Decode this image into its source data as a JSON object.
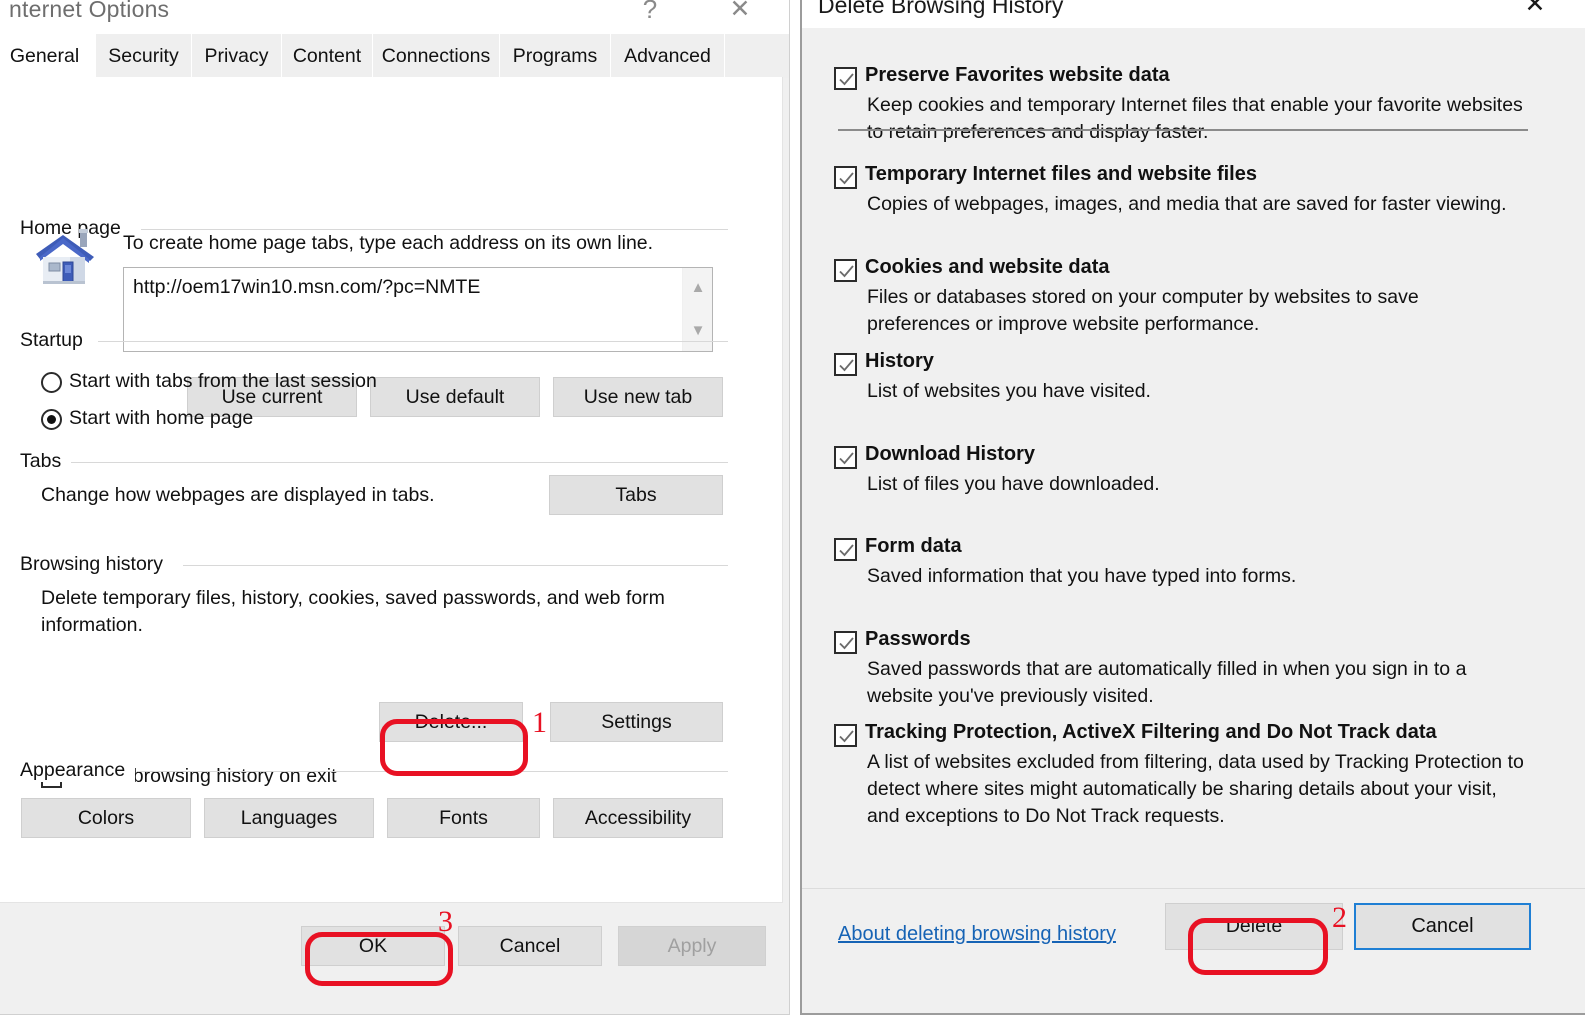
{
  "internet_options": {
    "window_title": "nternet Options",
    "titlebar_buttons": {
      "help": "?",
      "close": "✕"
    },
    "tabs": [
      {
        "label": "General",
        "active": true
      },
      {
        "label": "Security",
        "active": false
      },
      {
        "label": "Privacy",
        "active": false
      },
      {
        "label": "Content",
        "active": false
      },
      {
        "label": "Connections",
        "active": false
      },
      {
        "label": "Programs",
        "active": false
      },
      {
        "label": "Advanced",
        "active": false
      }
    ],
    "home_page": {
      "group_label": "Home page",
      "instruction": "To create home page tabs, type each address on its own line.",
      "url_value": "http://oem17win10.msn.com/?pc=NMTE",
      "icon": "home-house-icon",
      "buttons": [
        "Use current",
        "Use default",
        "Use new tab"
      ]
    },
    "startup": {
      "group_label": "Startup",
      "options": [
        {
          "label": "Start with tabs from the last session",
          "selected": false
        },
        {
          "label": "Start with home page",
          "selected": true
        }
      ]
    },
    "tabs_section": {
      "group_label": "Tabs",
      "description": "Change how webpages are displayed in tabs.",
      "button": "Tabs"
    },
    "browsing_history": {
      "group_label": "Browsing history",
      "description": "Delete temporary files, history, cookies, saved passwords, and web form information.",
      "checkbox": {
        "label": "Delete browsing history on exit",
        "checked": false
      },
      "buttons": [
        "Delete...",
        "Settings"
      ]
    },
    "appearance": {
      "group_label": "Appearance",
      "buttons": [
        "Colors",
        "Languages",
        "Fonts",
        "Accessibility"
      ]
    },
    "footer_buttons": [
      {
        "label": "OK",
        "disabled": false
      },
      {
        "label": "Cancel",
        "disabled": false
      },
      {
        "label": "Apply",
        "disabled": true
      }
    ]
  },
  "delete_browsing_history": {
    "window_title": "Delete Browsing History",
    "close_label": "✕",
    "items": [
      {
        "label": "Preserve Favorites website data",
        "checked": true,
        "description": "Keep cookies and temporary Internet files that enable your favorite websites to retain preferences and display faster."
      },
      {
        "label": "Temporary Internet files and website files",
        "checked": true,
        "description": "Copies of webpages, images, and media that are saved for faster viewing."
      },
      {
        "label": "Cookies and website data",
        "checked": true,
        "description": "Files or databases stored on your computer by websites to save preferences or improve website performance."
      },
      {
        "label": "History",
        "checked": true,
        "description": "List of websites you have visited."
      },
      {
        "label": "Download History",
        "checked": true,
        "description": "List of files you have downloaded."
      },
      {
        "label": "Form data",
        "checked": true,
        "description": "Saved information that you have typed into forms."
      },
      {
        "label": "Passwords",
        "checked": true,
        "description": "Saved passwords that are automatically filled in when you sign in to a website you've previously visited."
      },
      {
        "label": "Tracking Protection, ActiveX Filtering and Do Not Track data",
        "checked": true,
        "description": "A list of websites excluded from filtering, data used by Tracking Protection to detect where sites might automatically be sharing details about your visit, and exceptions to Do Not Track requests."
      }
    ],
    "footer": {
      "link": "About deleting browsing history",
      "delete_button": "Delete",
      "cancel_button": "Cancel"
    }
  },
  "annotations": {
    "color": "#e81123",
    "markers": [
      {
        "number": "1",
        "target": "delete-ellipsis-button"
      },
      {
        "number": "2",
        "target": "dbh-delete-button"
      },
      {
        "number": "3",
        "target": "ok-button"
      }
    ]
  }
}
